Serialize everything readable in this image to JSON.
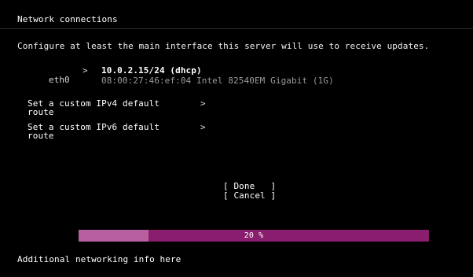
{
  "header": {
    "title": "Network connections"
  },
  "subtitle": "Configure at least the main interface this server will use to receive updates.",
  "interfaces": [
    {
      "name": "eth0",
      "arrow": ">",
      "address": "10.0.2.15/24 (dhcp)",
      "detail": "08:00:27:46:ef:04 Intel 82540EM Gigabit (1G)"
    }
  ],
  "routes": [
    {
      "label": "Set a custom IPv4 default route",
      "arrow": ">"
    },
    {
      "label": "Set a custom IPv6 default route",
      "arrow": ">"
    }
  ],
  "buttons": {
    "done": "[ Done   ]",
    "cancel": "[ Cancel ]"
  },
  "progress": {
    "fraction": 0.2,
    "text": "20 %"
  },
  "footer": "Additional networking info here",
  "colors": {
    "background": "#000000",
    "progress_track": "#8a1e6e",
    "progress_fill": "#b8609f",
    "text": "#ffffff",
    "muted_text": "#9a9a9a"
  }
}
